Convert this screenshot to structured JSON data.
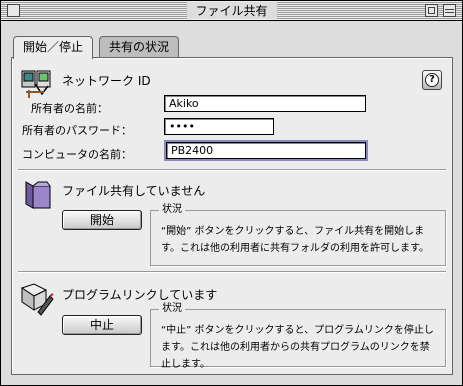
{
  "window": {
    "title": "ファイル共有"
  },
  "tabs": [
    {
      "label": "開始／停止",
      "active": true
    },
    {
      "label": "共有の状況",
      "active": false
    }
  ],
  "network": {
    "heading": "ネットワーク ID",
    "owner_name_label": "所有者の名前：",
    "owner_name_value": "Akiko",
    "password_label": "所有者のパスワード：",
    "password_value": "••••",
    "computer_name_label": "コンピュータの名前：",
    "computer_name_value": "PB2400"
  },
  "file_sharing": {
    "heading": "ファイル共有していません",
    "button_label": "開始",
    "status_title": "状況",
    "status_text": "“開始” ボタンをクリックすると、ファイル共有を開始します。これは他の利用者に共有フォルダの利用を許可します。"
  },
  "program_linking": {
    "heading": "プログラムリンクしています",
    "button_label": "中止",
    "status_title": "状況",
    "status_text": "“中止” ボタンをクリックすると、プログラムリンクを停止します。これは他の利用者からの共有プログラムのリンクを禁止します。"
  },
  "colors": {
    "focus_ring": "#8a8abf",
    "panel": "#ececec",
    "folder": "#9a86c8"
  },
  "icons": [
    "close-box-icon",
    "zoom-box-icon",
    "collapse-box-icon",
    "network-id-icon",
    "help-icon",
    "shared-folder-icon",
    "program-link-icon"
  ]
}
